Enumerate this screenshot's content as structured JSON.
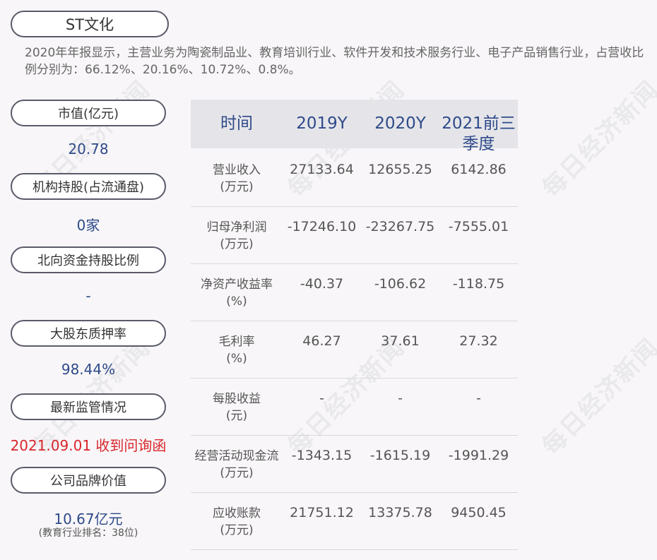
{
  "title": "ST文化",
  "intro": "2020年年报显示，主营业务为陶瓷制品业、教育培训行业、软件开发和技术服务行业、电子产品销售行业，占营收比例分别为：66.12%、20.16%、10.72%、0.8%。",
  "side": [
    {
      "label": "市值(亿元)",
      "value": "20.78"
    },
    {
      "label": "机构持股(占流通盘)",
      "value": "0家"
    },
    {
      "label": "北向资金持股比例",
      "value": "-"
    },
    {
      "label": "大股东质押率",
      "value": "98.44%"
    },
    {
      "label": "最新监管情况",
      "value": "2021.09.01 收到问询函"
    },
    {
      "label": "公司品牌价值",
      "value": "10.67亿元",
      "sub": "(教育行业排名：38位)"
    }
  ],
  "table": {
    "headers": [
      "时间",
      "2019Y",
      "2020Y",
      "2021前三季度"
    ],
    "rows": [
      {
        "label": "营业收入(万元)",
        "values": [
          "27133.64",
          "12655.25",
          "6142.86"
        ]
      },
      {
        "label": "归母净利润(万元)",
        "values": [
          "-17246.10",
          "-23267.75",
          "-7555.01"
        ]
      },
      {
        "label": "净资产收益率(%)",
        "values": [
          "-40.37",
          "-106.62",
          "-118.75"
        ]
      },
      {
        "label": "毛利率(%)",
        "values": [
          "46.27",
          "37.61",
          "27.32"
        ]
      },
      {
        "label": "每股收益(元)",
        "values": [
          "-",
          "-",
          "-"
        ]
      },
      {
        "label": "经营活动现金流(万元)",
        "values": [
          "-1343.15",
          "-1615.19",
          "-1991.29"
        ]
      },
      {
        "label": "应收账款(万元)",
        "values": [
          "21751.12",
          "13375.78",
          "9450.45"
        ]
      }
    ]
  },
  "watermark": "每日经济新闻",
  "colors": {
    "accent": "#2e4a8a",
    "alert": "#d7262c",
    "header_bg": "#e5e5e9",
    "background": "#f8f6f8"
  }
}
